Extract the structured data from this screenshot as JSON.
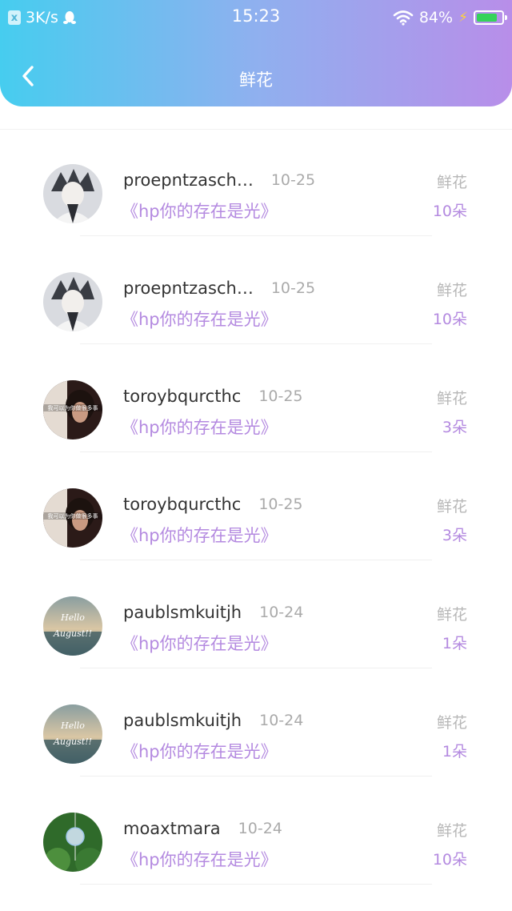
{
  "status": {
    "speed": "3K/s",
    "time": "15:23",
    "battery": "84%",
    "battery_level": 0.84
  },
  "nav": {
    "title": "鲜花"
  },
  "list": [
    {
      "name": "proepntzasch…",
      "date": "10-25",
      "book": "《hp你的存在是光》",
      "gift": "鲜花",
      "count": "10朵",
      "avatar": "anime-boy"
    },
    {
      "name": "proepntzasch…",
      "date": "10-25",
      "book": "《hp你的存在是光》",
      "gift": "鲜花",
      "count": "10朵",
      "avatar": "anime-boy"
    },
    {
      "name": "toroybqurcthc",
      "date": "10-25",
      "book": "《hp你的存在是光》",
      "gift": "鲜花",
      "count": "3朵",
      "avatar": "portrait"
    },
    {
      "name": "toroybqurcthc",
      "date": "10-25",
      "book": "《hp你的存在是光》",
      "gift": "鲜花",
      "count": "3朵",
      "avatar": "portrait"
    },
    {
      "name": "paublsmkuitjh",
      "date": "10-24",
      "book": "《hp你的存在是光》",
      "gift": "鲜花",
      "count": "1朵",
      "avatar": "hello-august"
    },
    {
      "name": "paublsmkuitjh",
      "date": "10-24",
      "book": "《hp你的存在是光》",
      "gift": "鲜花",
      "count": "1朵",
      "avatar": "hello-august"
    },
    {
      "name": "moaxtmara",
      "date": "10-24",
      "book": "《hp你的存在是光》",
      "gift": "鲜花",
      "count": "10朵",
      "avatar": "wind-chime"
    }
  ],
  "avatar_text": {
    "portrait": "我可以为你做很多事",
    "hello_august_line1": "Hello",
    "hello_august_line2": "August!!"
  }
}
